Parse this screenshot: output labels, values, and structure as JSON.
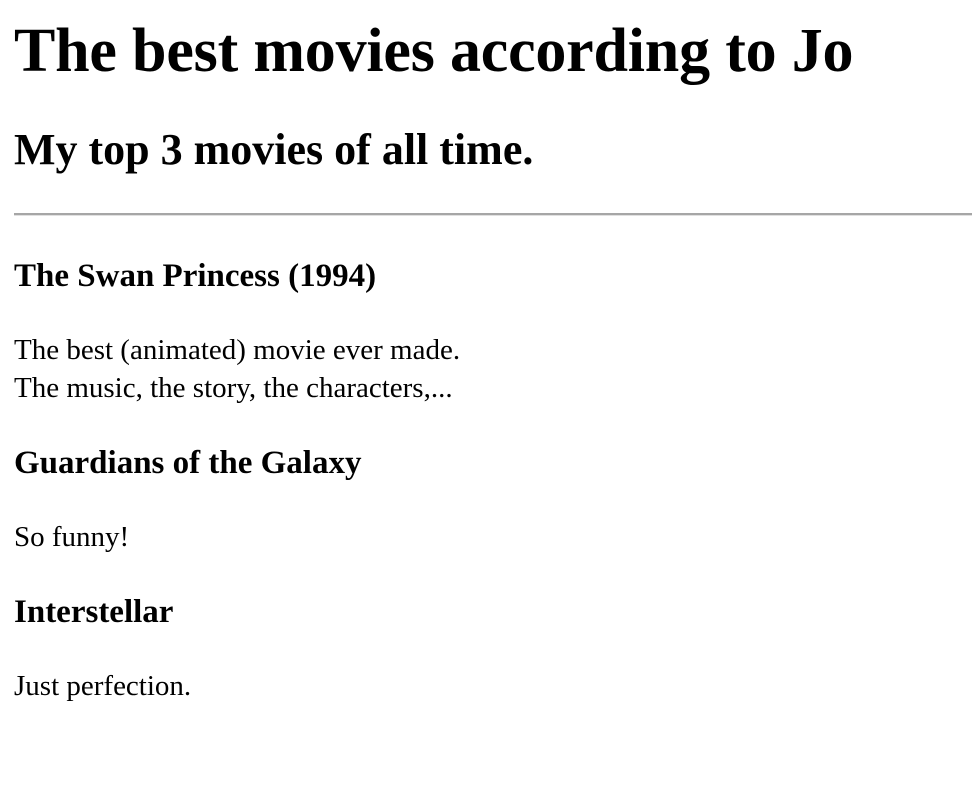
{
  "page": {
    "title": "The best movies according to Jo",
    "subtitle": "My top 3 movies of all time."
  },
  "movies": [
    {
      "title": "The Swan Princess (1994)",
      "lines": [
        "The best (animated) movie ever made.",
        "The music, the story, the characters,..."
      ]
    },
    {
      "title": "Guardians of the Galaxy",
      "lines": [
        "So funny!"
      ]
    },
    {
      "title": "Interstellar",
      "lines": [
        "Just perfection."
      ]
    }
  ]
}
